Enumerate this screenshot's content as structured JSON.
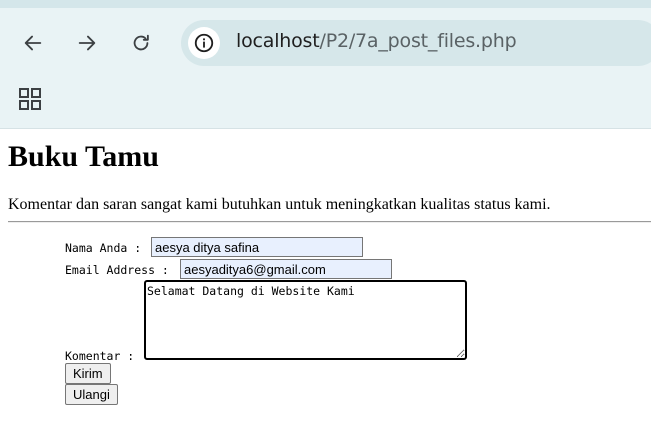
{
  "browser": {
    "url_host": "localhost",
    "url_path": "/P2/7a_post_files.php",
    "icons": [
      "back-arrow-icon",
      "forward-arrow-icon",
      "reload-icon",
      "site-info-icon",
      "apps-grid-icon"
    ]
  },
  "page": {
    "title": "Buku Tamu",
    "description": "Komentar dan saran sangat kami butuhkan untuk meningkatkan kualitas status kami."
  },
  "form": {
    "name_label": "Nama Anda :",
    "name_value": "aesya ditya safina",
    "email_label": "Email Address :",
    "email_value": "aesyaditya6@gmail.com",
    "comment_label": "Komentar :",
    "comment_value": "Selamat Datang di Website Kami",
    "submit_label": "Kirim",
    "reset_label": "Ulangi"
  },
  "colors": {
    "chrome_bg": "#e9f3f5",
    "omnibox_bg": "#d6e7ea",
    "autofill_bg": "#e8f0fe"
  }
}
